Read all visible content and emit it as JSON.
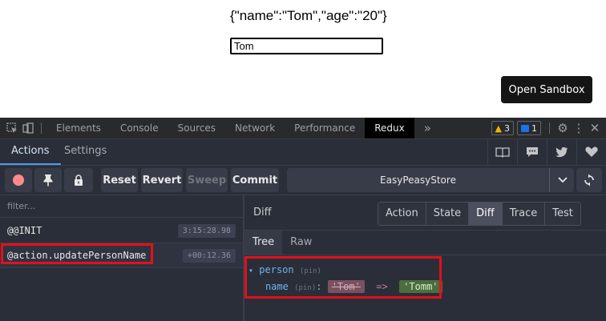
{
  "preview": {
    "json_text": "{\"name\":\"Tom\",\"age\":\"20\"}",
    "name_input_value": "Tom",
    "sandbox_button": "Open Sandbox"
  },
  "devtools": {
    "tabs": [
      "Elements",
      "Console",
      "Sources",
      "Network",
      "Performance",
      "Redux"
    ],
    "active_tab": "Redux",
    "more_tabs": "»",
    "warnings_count": "3",
    "messages_count": "1",
    "colors": {
      "warning": "#f2b600",
      "messages": "#1a73e8"
    }
  },
  "redux": {
    "tabs": {
      "actions": "Actions",
      "settings": "Settings"
    },
    "toolbar": {
      "reset": "Reset",
      "revert": "Revert",
      "sweep": "Sweep",
      "commit": "Commit",
      "store": "EasyPeasyStore"
    },
    "filter_placeholder": "filter...",
    "actions": [
      {
        "name": "@@INIT",
        "time": "3:15:28.98"
      },
      {
        "name": "@action.updatePersonName",
        "time": "+00:12.36"
      }
    ],
    "monitor": {
      "title": "Diff",
      "buttons": [
        "Action",
        "State",
        "Diff",
        "Trace",
        "Test"
      ],
      "active_button": "Diff",
      "subtabs": [
        "Tree",
        "Raw"
      ],
      "active_subtab": "Tree"
    },
    "diff_tree": {
      "expander": "▾",
      "root_key": "person",
      "root_pin": "(pin)",
      "child_key": "name",
      "child_pin": "(pin)",
      "colon": ":",
      "old_value": "'Tom'",
      "arrow": "=>",
      "new_value": "'Tomm'"
    },
    "highlight_color": "#e3101a"
  }
}
